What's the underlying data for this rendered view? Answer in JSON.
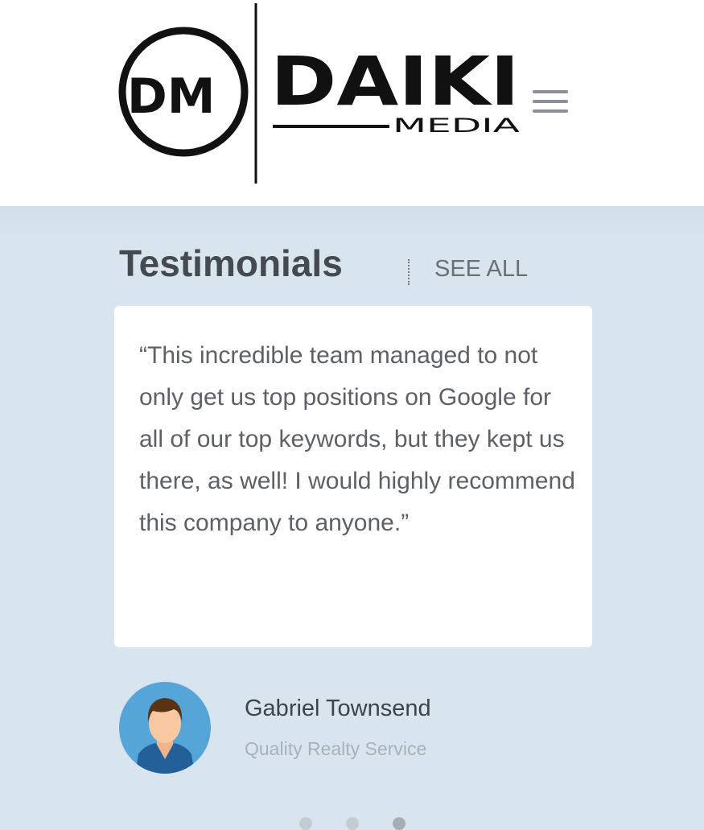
{
  "header": {
    "logo_text": "DAIKI MEDIA",
    "logo_monogram": "DM",
    "menu_icon": "hamburger-icon"
  },
  "testimonials": {
    "title": "Testimonials",
    "see_all": "SEE ALL",
    "quote": "“This incredible team managed to not only get us top positions on Google for all of our top keywords, but they kept us there, as well! I would highly recommend this company to anyone.”",
    "author_name": "Gabriel Townsend",
    "author_company": "Quality Realty Service",
    "slides": 3,
    "active_slide": 3
  }
}
